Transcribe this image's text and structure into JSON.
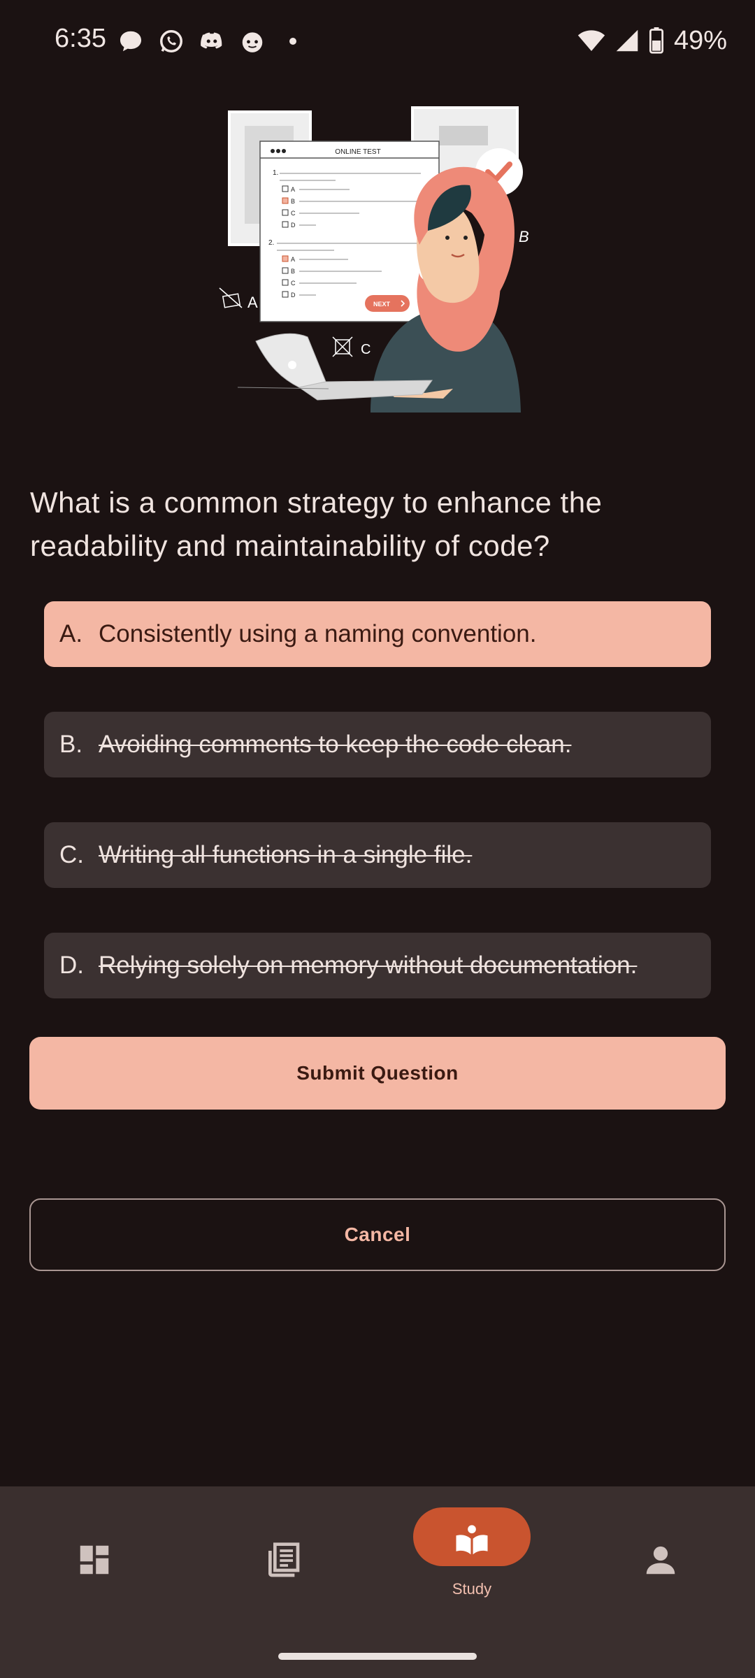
{
  "status_bar": {
    "time": "6:35",
    "battery_percent": "49%",
    "notification_icons": [
      "chat-bubble-icon",
      "whatsapp-icon",
      "discord-icon",
      "reddit-icon"
    ]
  },
  "quiz": {
    "question": "What is a common strategy to enhance the readability and maintainability of code?",
    "options": [
      {
        "letter": "A.",
        "text": "Consistently using a naming convention.",
        "state": "selected"
      },
      {
        "letter": "B.",
        "text": "Avoiding comments to keep the code clean.",
        "state": "struck"
      },
      {
        "letter": "C.",
        "text": "Writing all functions in a single file.",
        "state": "struck"
      },
      {
        "letter": "D.",
        "text": "Relying solely on memory without documentation.",
        "state": "struck"
      }
    ],
    "submit_label": "Submit Question",
    "cancel_label": "Cancel"
  },
  "illustration": {
    "header": "ONLINE TEST",
    "q1": "1.",
    "q2": "2.",
    "choices": [
      "A",
      "B",
      "C",
      "D"
    ],
    "next_label": "NEXT",
    "floating_letters": [
      "A",
      "B",
      "C"
    ]
  },
  "bottom_nav": {
    "items": [
      {
        "icon": "dashboard-icon",
        "label": ""
      },
      {
        "icon": "articles-icon",
        "label": ""
      },
      {
        "icon": "study-book-icon",
        "label": "Study",
        "active": true
      },
      {
        "icon": "profile-icon",
        "label": ""
      }
    ]
  },
  "colors": {
    "background": "#1b1212",
    "accent": "#f4b7a4",
    "active_pill": "#c9542f",
    "option_bg": "#3b3131",
    "nav_bg": "#3a2f2e"
  }
}
